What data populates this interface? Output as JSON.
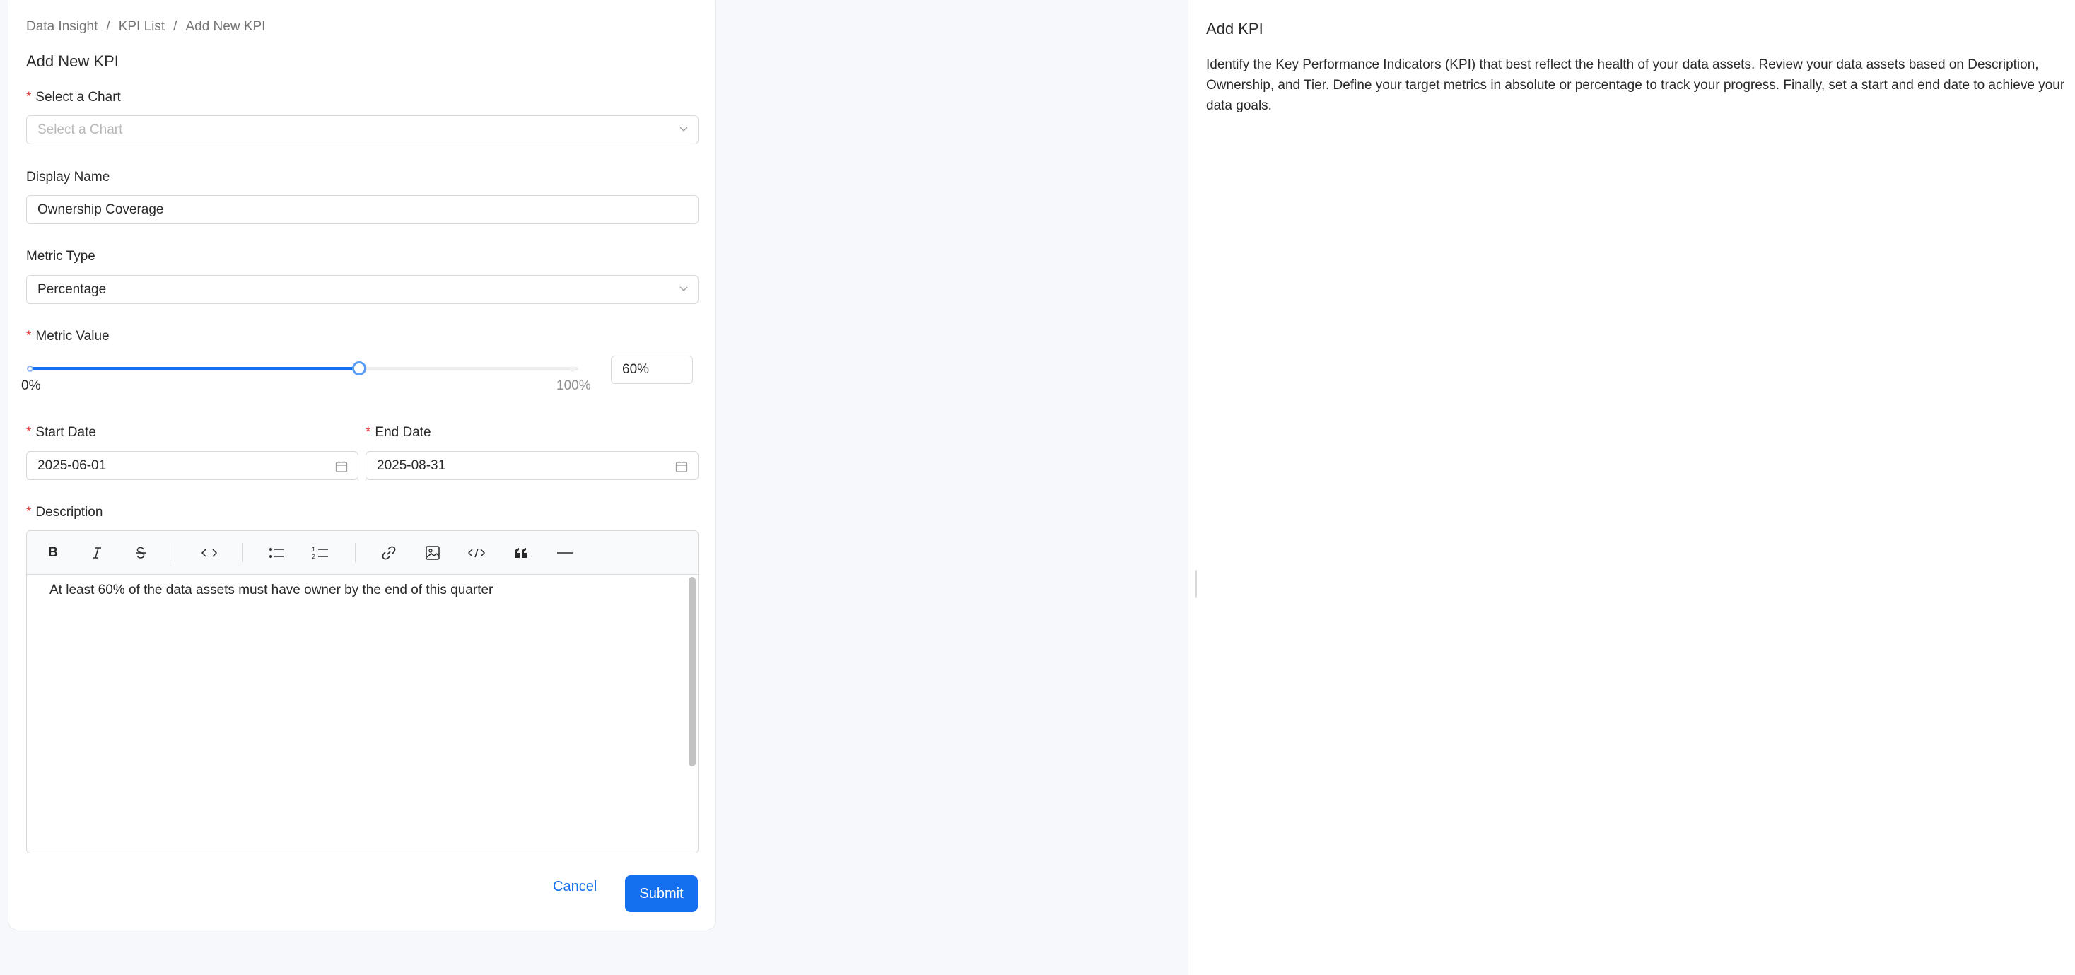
{
  "breadcrumb": [
    "Data Insight",
    "KPI List",
    "Add New KPI"
  ],
  "page_title": "Add New KPI",
  "form": {
    "chart": {
      "label": "Select a Chart",
      "required": true,
      "placeholder": "Select a Chart",
      "value": ""
    },
    "display_name": {
      "label": "Display Name",
      "value": "Ownership Coverage"
    },
    "metric_type": {
      "label": "Metric Type",
      "value": "Percentage"
    },
    "metric_value": {
      "label": "Metric Value",
      "required": true,
      "min_label": "0%",
      "max_label": "100%",
      "value": 60,
      "value_text": "60%"
    },
    "start_date": {
      "label": "Start Date",
      "required": true,
      "value": "2025-06-01"
    },
    "end_date": {
      "label": "End Date",
      "required": true,
      "value": "2025-08-31"
    },
    "description": {
      "label": "Description",
      "required": true,
      "toolbar": [
        "bold-icon",
        "italic-icon",
        "strikethrough-icon",
        "inline-code-icon",
        "bullet-list-icon",
        "numbered-list-icon",
        "link-icon",
        "image-icon",
        "code-block-icon",
        "quote-icon",
        "horizontal-rule-icon"
      ],
      "value": "At least 60% of the data assets must have owner by the end of this quarter"
    },
    "cancel_label": "Cancel",
    "submit_label": "Submit"
  },
  "help": {
    "title": "Add KPI",
    "body": "Identify the Key Performance Indicators (KPI) that best reflect the health of your data assets. Review your data assets based on Description, Ownership, and Tier. Define your target metrics in absolute or percentage to track your progress. Finally, set a start and end date to achieve your data goals."
  },
  "colors": {
    "accent": "#1570ef",
    "required": "#e03b3b",
    "page_bg": "#f7f8fb"
  }
}
